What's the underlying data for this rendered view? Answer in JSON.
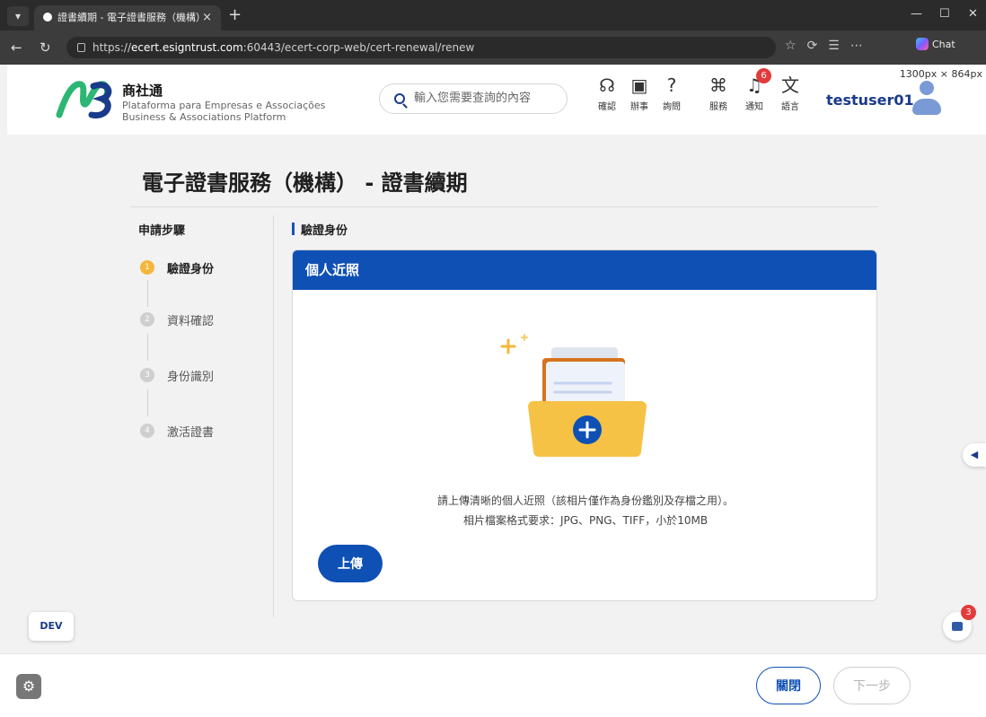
{
  "browser": {
    "tab_title": "證書續期 - 電子證書服務（機構）",
    "tab_close": "×",
    "new_tab": "+",
    "url_prefix": "https://",
    "url_host": "ecert.esigntrust.com",
    "url_path": ":60443/ecert-corp-web/cert-renewal/renew",
    "chat_label": "Chat",
    "viewport_size": "1300px × 864px"
  },
  "header": {
    "brand_name": "商社通",
    "brand_sub1": "Plataforma para Empresas e Associações",
    "brand_sub2": "Business & Associations Platform",
    "search_placeholder": "輸入您需要查詢的內容",
    "nav": [
      {
        "label": "確認",
        "icon": "confirm-icon"
      },
      {
        "label": "辦事",
        "icon": "briefcase-icon"
      },
      {
        "label": "詢問",
        "icon": "question-icon"
      },
      {
        "label": "服務",
        "icon": "services-grid-icon"
      },
      {
        "label": "通知",
        "icon": "bell-icon",
        "badge": "6"
      },
      {
        "label": "語言",
        "icon": "translate-icon"
      }
    ],
    "username": "testuser01"
  },
  "page": {
    "title": "電子證書服務（機構） - 證書續期",
    "steps_title": "申請步驟",
    "steps": [
      {
        "num": "1",
        "label": "驗證身份",
        "active": true
      },
      {
        "num": "2",
        "label": "資料確認",
        "active": false
      },
      {
        "num": "3",
        "label": "身份識別",
        "active": false
      },
      {
        "num": "4",
        "label": "激活證書",
        "active": false
      }
    ],
    "section_title": "驗證身份",
    "card": {
      "header": "個人近照",
      "desc1": "請上傳清晰的個人近照（該相片僅作為身份鑑別及存檔之用）。",
      "desc2": "相片檔案格式要求：JPG、PNG、TIFF，小於10MB",
      "upload_label": "上傳"
    }
  },
  "floating": {
    "dev_label": "DEV",
    "help_badge": "3"
  },
  "footer": {
    "close_label": "關閉",
    "next_label": "下一步"
  },
  "colors": {
    "primary": "#0f50b4",
    "step_active": "#f5b73b",
    "badge": "#e23b3b",
    "folder": "#f5c245"
  }
}
